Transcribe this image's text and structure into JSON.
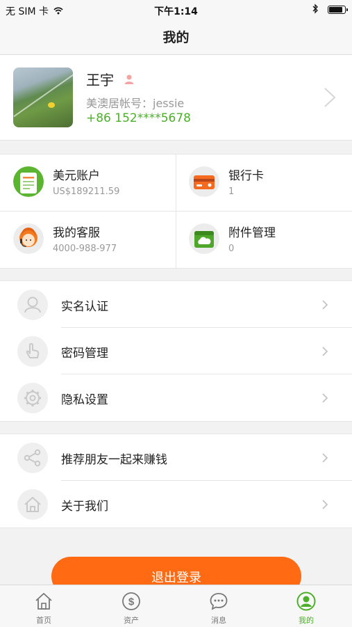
{
  "status_bar": {
    "carrier": "无 SIM 卡",
    "time": "下午1:14"
  },
  "nav": {
    "title": "我的"
  },
  "profile": {
    "name": "王宇",
    "account": "美澳居帐号：jessie",
    "phone": "+86 152****5678"
  },
  "cards": [
    {
      "title": "美元账户",
      "value": "US$189211.59",
      "icon": "ledger-icon"
    },
    {
      "title": "银行卡",
      "value": "1",
      "icon": "bank-card-icon"
    },
    {
      "title": "我的客服",
      "value": "4000-988-977",
      "icon": "customer-service-icon"
    },
    {
      "title": "附件管理",
      "value": "0",
      "icon": "folder-cloud-icon"
    }
  ],
  "menu_group1": [
    {
      "label": "实名认证",
      "icon": "user-icon"
    },
    {
      "label": "密码管理",
      "icon": "hand-icon"
    },
    {
      "label": "隐私设置",
      "icon": "gear-icon"
    }
  ],
  "menu_group2": [
    {
      "label": "推荐朋友一起来赚钱",
      "icon": "share-icon"
    },
    {
      "label": "关于我们",
      "icon": "home-icon"
    }
  ],
  "logout_label": "退出登录",
  "tabs": [
    {
      "label": "首页",
      "icon": "home-icon"
    },
    {
      "label": "资产",
      "icon": "dollar-icon"
    },
    {
      "label": "消息",
      "icon": "chat-icon"
    },
    {
      "label": "我的",
      "icon": "profile-icon"
    }
  ],
  "colors": {
    "accent_green": "#4caf2a",
    "logout_orange": "#ff6a13"
  }
}
